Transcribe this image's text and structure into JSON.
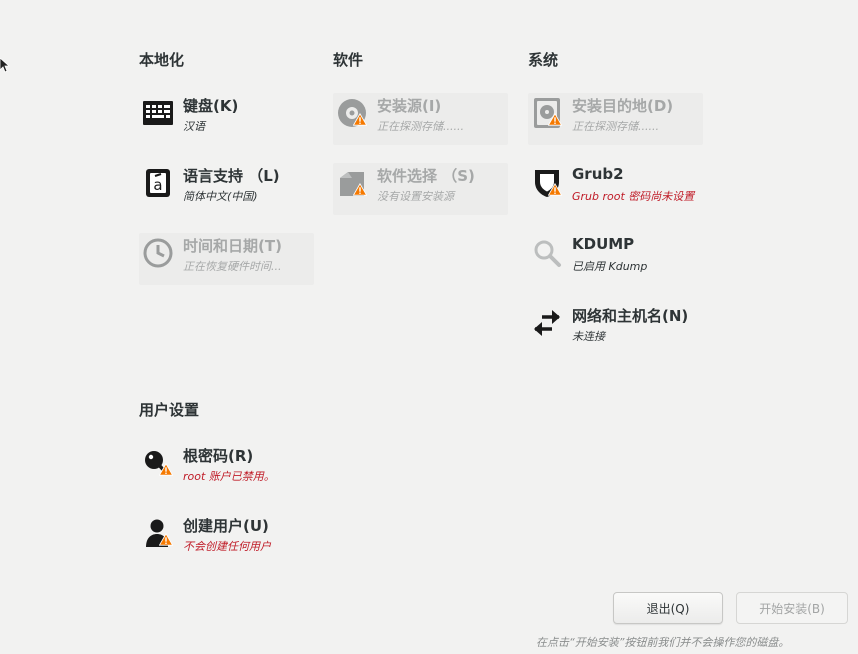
{
  "sections": {
    "localization": "本地化",
    "software": "软件",
    "system": "系统",
    "user_settings": "用户设置"
  },
  "spokes": {
    "keyboard": {
      "title": "键盘(K)",
      "status": "汉语",
      "state": "normal"
    },
    "language": {
      "title": "语言支持 （L)",
      "status": "简体中文(中国)",
      "state": "normal"
    },
    "datetime": {
      "title": "时间和日期(T)",
      "status": "正在恢复硬件时间...",
      "state": "disabled"
    },
    "source": {
      "title": "安装源(I)",
      "status": "正在探测存储......",
      "state": "disabled",
      "warning": true
    },
    "software_selection": {
      "title": "软件选择 （S)",
      "status": "没有设置安装源",
      "state": "disabled",
      "warning": true
    },
    "destination": {
      "title": "安装目的地(D)",
      "status": "正在探测存储......",
      "state": "disabled",
      "warning": true
    },
    "grub": {
      "title": "Grub2",
      "status": "Grub root 密码尚未设置",
      "state": "warning",
      "warning": true
    },
    "kdump": {
      "title": "KDUMP",
      "status": "已启用 Kdump",
      "state": "normal"
    },
    "network": {
      "title": "网络和主机名(N)",
      "status": "未连接",
      "state": "normal"
    },
    "root_password": {
      "title": "根密码(R)",
      "status": "root 账户已禁用。",
      "state": "warning",
      "warning": true
    },
    "create_user": {
      "title": "创建用户(U)",
      "status": "不会创建任何用户",
      "state": "warning",
      "warning": true
    }
  },
  "buttons": {
    "quit": "退出(Q)",
    "begin_install": "开始安装(B)"
  },
  "footer_note": "在点击“开始安装”按钮前我们并不会操作您的磁盘。",
  "icons": {
    "keyboard": "keyboard-icon",
    "language": "language-icon",
    "datetime": "clock-icon",
    "source": "disc-icon",
    "software_selection": "package-icon",
    "destination": "harddisk-icon",
    "grub": "shield-icon",
    "kdump": "magnifier-icon",
    "network": "network-arrows-icon",
    "root_password": "key-icon",
    "create_user": "user-icon",
    "warning": "warning-triangle-icon"
  },
  "colors": {
    "background": "#f2f2f1",
    "text": "#2e3436",
    "disabled_text": "#a6a8a8",
    "warning_text": "#c01c28",
    "warning_badge": "#f57900"
  }
}
